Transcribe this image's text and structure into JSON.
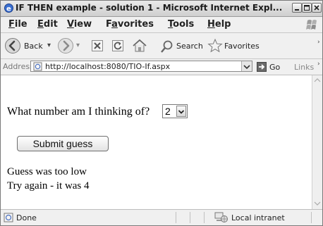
{
  "window": {
    "title": "IF THEN example - solution 1 - Microsoft Internet Expl..."
  },
  "menu": [
    {
      "label": "File",
      "accel": "F",
      "rest": "ile"
    },
    {
      "label": "Edit",
      "accel": "E",
      "rest": "dit"
    },
    {
      "label": "View",
      "accel": "V",
      "rest": "iew"
    },
    {
      "label": "Favorites",
      "accel": "a",
      "pre": "F",
      "rest": "vorites"
    },
    {
      "label": "Tools",
      "accel": "T",
      "rest": "ools"
    },
    {
      "label": "Help",
      "accel": "H",
      "rest": "elp"
    }
  ],
  "toolbar": {
    "back_label": "Back",
    "search_label": "Search",
    "favorites_label": "Favorites"
  },
  "address": {
    "label": "Address",
    "url": "http://localhost:8080/TIO-If.aspx",
    "go_label": "Go",
    "links_label": "Links"
  },
  "page": {
    "question": "What number am I thinking of?",
    "selected_number": "2",
    "submit_label": "Submit guess",
    "result_line1": "Guess was too low",
    "result_line2": "Try again - it was 4"
  },
  "status": {
    "left": "Done",
    "zone": "Local intranet"
  }
}
